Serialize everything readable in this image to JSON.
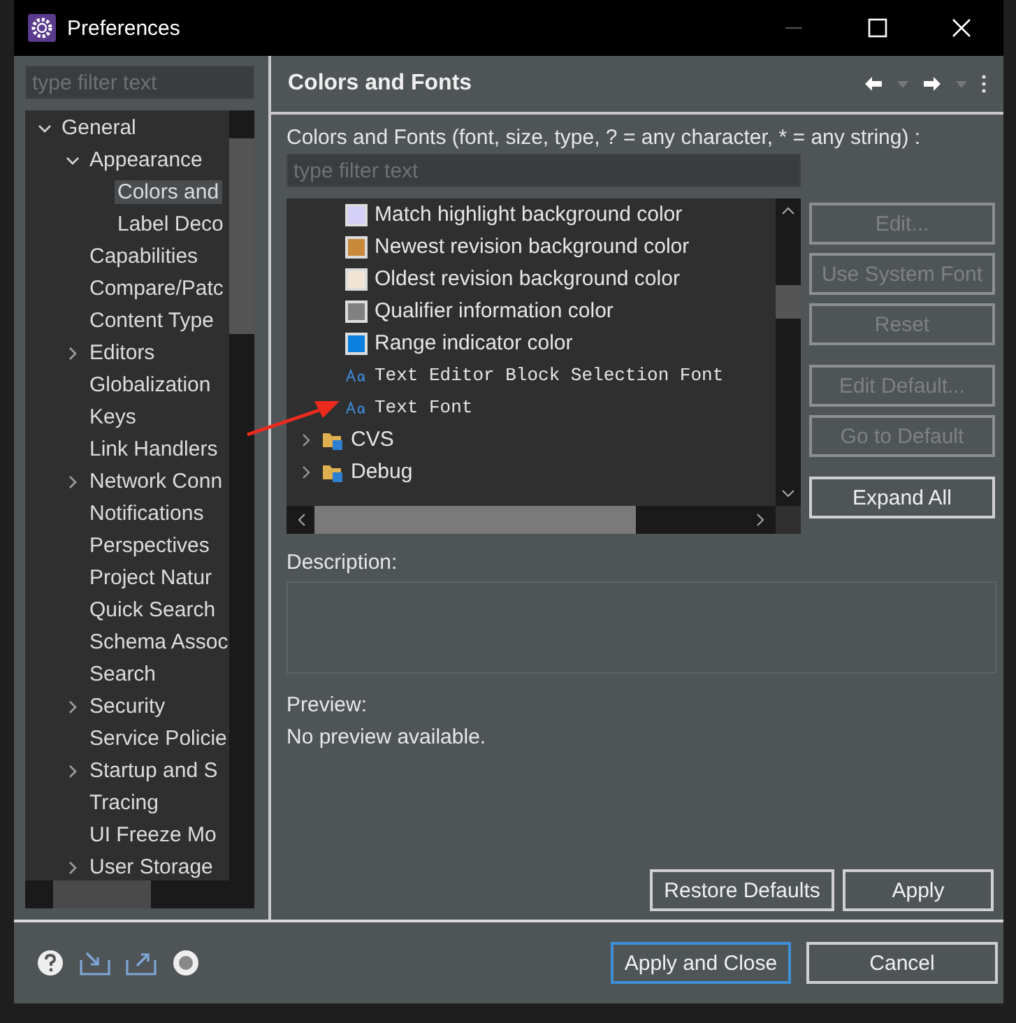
{
  "window": {
    "title": "Preferences"
  },
  "sidebar": {
    "filter": {
      "placeholder": "type filter text"
    },
    "tree": [
      {
        "label": "General",
        "expanded": true,
        "selected": false,
        "children": [
          {
            "label": "Appearance",
            "expanded": true,
            "selected": false,
            "children": [
              {
                "label": "Colors and",
                "selected": true
              },
              {
                "label": "Label Deco",
                "selected": false
              }
            ]
          },
          {
            "label": "Capabilities",
            "selected": false
          },
          {
            "label": "Compare/Patc",
            "selected": false
          },
          {
            "label": "Content Type",
            "selected": false
          },
          {
            "label": "Editors",
            "expanded": false,
            "selected": false
          },
          {
            "label": "Globalization",
            "selected": false
          },
          {
            "label": "Keys",
            "selected": false
          },
          {
            "label": "Link Handlers",
            "selected": false
          },
          {
            "label": "Network Conn",
            "expanded": false,
            "selected": false
          },
          {
            "label": "Notifications",
            "selected": false
          },
          {
            "label": "Perspectives",
            "selected": false
          },
          {
            "label": "Project Natur",
            "selected": false
          },
          {
            "label": "Quick Search",
            "selected": false
          },
          {
            "label": "Schema Assoc",
            "selected": false
          },
          {
            "label": "Search",
            "selected": false
          },
          {
            "label": "Security",
            "expanded": false,
            "selected": false
          },
          {
            "label": "Service Policie",
            "selected": false
          },
          {
            "label": "Startup and S",
            "expanded": false,
            "selected": false
          },
          {
            "label": "Tracing",
            "selected": false
          },
          {
            "label": "UI Freeze Mo",
            "selected": false
          },
          {
            "label": "User Storage",
            "expanded": false,
            "selected": false
          }
        ]
      }
    ]
  },
  "page": {
    "title": "Colors and Fonts",
    "filter_label": "Colors and Fonts (font, size, type, ? = any character, * = any string) :",
    "filter": {
      "placeholder": "type filter text"
    },
    "items": [
      {
        "kind": "color",
        "label": "Match highlight background color",
        "color": "#d4d0f8"
      },
      {
        "kind": "color",
        "label": "Newest revision background color",
        "color": "#c88a3a"
      },
      {
        "kind": "color",
        "label": "Oldest revision background color",
        "color": "#f2e4d2"
      },
      {
        "kind": "color",
        "label": "Qualifier information color",
        "color": "#808080"
      },
      {
        "kind": "color",
        "label": "Range indicator color",
        "color": "#0a7fe0"
      },
      {
        "kind": "font",
        "label": "Text Editor Block Selection Font"
      },
      {
        "kind": "font",
        "label": "Text Font"
      },
      {
        "kind": "category",
        "label": "CVS",
        "expanded": false
      },
      {
        "kind": "category",
        "label": "Debug",
        "expanded": false
      }
    ],
    "side_buttons": [
      {
        "label": "Edit...",
        "disabled": true
      },
      {
        "label": "Use System Font",
        "disabled": true
      },
      {
        "label": "Reset",
        "disabled": true
      },
      {
        "label": "Edit Default...",
        "disabled": true
      },
      {
        "label": "Go to Default",
        "disabled": true
      },
      {
        "label": "Expand All",
        "disabled": false
      }
    ],
    "description_label": "Description:",
    "preview_label": "Preview:",
    "preview_text": "No preview available.",
    "buttons": [
      "Restore Defaults",
      "Apply"
    ]
  },
  "footer": {
    "buttons": [
      {
        "label": "Apply and Close",
        "focused": true
      },
      {
        "label": "Cancel",
        "focused": false
      }
    ]
  }
}
